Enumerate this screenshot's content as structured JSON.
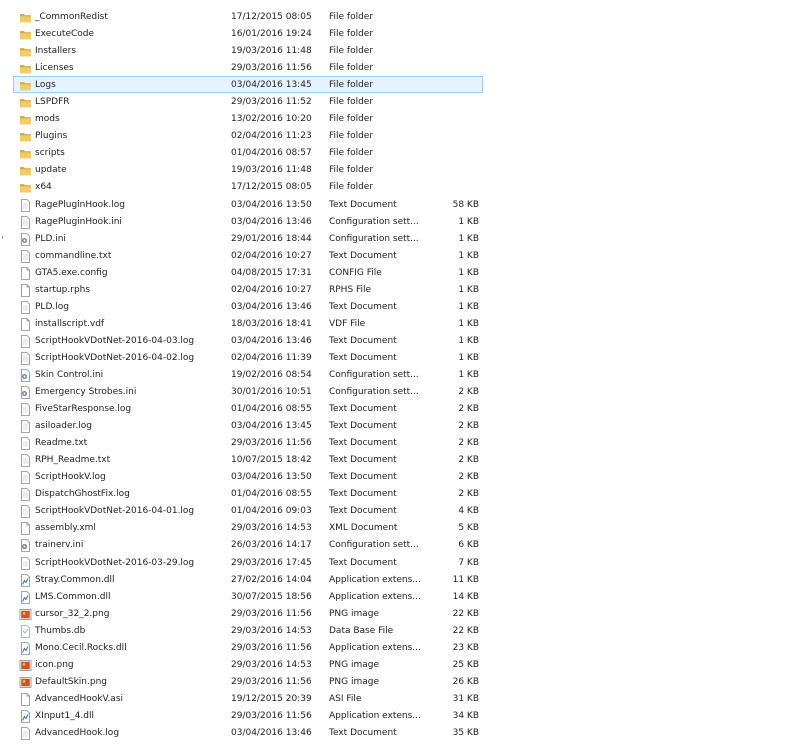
{
  "colors": {
    "selection_bg": "#e5f3ff",
    "selection_border": "#99d1ff",
    "folder": "#e8c153"
  },
  "files": [
    {
      "name": "_CommonRedist",
      "date": "17/12/2015 08:05",
      "type": "File folder",
      "size": "",
      "icon": "folder-icon"
    },
    {
      "name": "ExecuteCode",
      "date": "16/01/2016 19:24",
      "type": "File folder",
      "size": "",
      "icon": "folder-icon"
    },
    {
      "name": "Installers",
      "date": "19/03/2016 11:48",
      "type": "File folder",
      "size": "",
      "icon": "folder-icon"
    },
    {
      "name": "Licenses",
      "date": "29/03/2016 11:56",
      "type": "File folder",
      "size": "",
      "icon": "folder-icon"
    },
    {
      "name": "Logs",
      "date": "03/04/2016 13:45",
      "type": "File folder",
      "size": "",
      "icon": "folder-icon",
      "selected": true
    },
    {
      "name": "LSPDFR",
      "date": "29/03/2016 11:52",
      "type": "File folder",
      "size": "",
      "icon": "folder-icon"
    },
    {
      "name": "mods",
      "date": "13/02/2016 10:20",
      "type": "File folder",
      "size": "",
      "icon": "folder-icon"
    },
    {
      "name": "Plugins",
      "date": "02/04/2016 11:23",
      "type": "File folder",
      "size": "",
      "icon": "folder-icon"
    },
    {
      "name": "scripts",
      "date": "01/04/2016 08:57",
      "type": "File folder",
      "size": "",
      "icon": "folder-icon"
    },
    {
      "name": "update",
      "date": "19/03/2016 11:48",
      "type": "File folder",
      "size": "",
      "icon": "folder-icon"
    },
    {
      "name": "x64",
      "date": "17/12/2015 08:05",
      "type": "File folder",
      "size": "",
      "icon": "folder-icon"
    },
    {
      "name": "RagePluginHook.log",
      "date": "03/04/2016 13:50",
      "type": "Text Document",
      "size": "58 KB",
      "icon": "text-file-icon"
    },
    {
      "name": "RagePluginHook.ini",
      "date": "03/04/2016 13:46",
      "type": "Configuration sett...",
      "size": "1 KB",
      "icon": "text-file-icon"
    },
    {
      "name": "PLD.ini",
      "date": "29/01/2016 18:44",
      "type": "Configuration sett...",
      "size": "1 KB",
      "icon": "config-file-icon"
    },
    {
      "name": "commandline.txt",
      "date": "02/04/2016 10:27",
      "type": "Text Document",
      "size": "1 KB",
      "icon": "text-file-icon"
    },
    {
      "name": "GTA5.exe.config",
      "date": "04/08/2015 17:31",
      "type": "CONFIG File",
      "size": "1 KB",
      "icon": "blank-file-icon"
    },
    {
      "name": "startup.rphs",
      "date": "02/04/2016 10:27",
      "type": "RPHS File",
      "size": "1 KB",
      "icon": "blank-file-icon"
    },
    {
      "name": "PLD.log",
      "date": "03/04/2016 13:46",
      "type": "Text Document",
      "size": "1 KB",
      "icon": "text-file-icon"
    },
    {
      "name": "installscript.vdf",
      "date": "18/03/2016 18:41",
      "type": "VDF File",
      "size": "1 KB",
      "icon": "blank-file-icon"
    },
    {
      "name": "ScriptHookVDotNet-2016-04-03.log",
      "date": "03/04/2016 13:46",
      "type": "Text Document",
      "size": "1 KB",
      "icon": "text-file-icon"
    },
    {
      "name": "ScriptHookVDotNet-2016-04-02.log",
      "date": "02/04/2016 11:39",
      "type": "Text Document",
      "size": "1 KB",
      "icon": "text-file-icon"
    },
    {
      "name": "Skin Control.ini",
      "date": "19/02/2016 08:54",
      "type": "Configuration sett...",
      "size": "1 KB",
      "icon": "config-file-icon"
    },
    {
      "name": "Emergency Strobes.ini",
      "date": "30/01/2016 10:51",
      "type": "Configuration sett...",
      "size": "2 KB",
      "icon": "config-file-icon"
    },
    {
      "name": "FiveStarResponse.log",
      "date": "01/04/2016 08:55",
      "type": "Text Document",
      "size": "2 KB",
      "icon": "text-file-icon"
    },
    {
      "name": "asiloader.log",
      "date": "03/04/2016 13:45",
      "type": "Text Document",
      "size": "2 KB",
      "icon": "text-file-icon"
    },
    {
      "name": "Readme.txt",
      "date": "29/03/2016 11:56",
      "type": "Text Document",
      "size": "2 KB",
      "icon": "text-file-icon"
    },
    {
      "name": "RPH_Readme.txt",
      "date": "10/07/2015 18:42",
      "type": "Text Document",
      "size": "2 KB",
      "icon": "text-file-icon"
    },
    {
      "name": "ScriptHookV.log",
      "date": "03/04/2016 13:50",
      "type": "Text Document",
      "size": "2 KB",
      "icon": "text-file-icon"
    },
    {
      "name": "DispatchGhostFix.log",
      "date": "01/04/2016 08:55",
      "type": "Text Document",
      "size": "2 KB",
      "icon": "text-file-icon"
    },
    {
      "name": "ScriptHookVDotNet-2016-04-01.log",
      "date": "01/04/2016 09:03",
      "type": "Text Document",
      "size": "4 KB",
      "icon": "text-file-icon"
    },
    {
      "name": "assembly.xml",
      "date": "29/03/2016 14:53",
      "type": "XML Document",
      "size": "5 KB",
      "icon": "blank-file-icon"
    },
    {
      "name": "trainerv.ini",
      "date": "26/03/2016 14:17",
      "type": "Configuration sett...",
      "size": "6 KB",
      "icon": "config-file-icon"
    },
    {
      "name": "ScriptHookVDotNet-2016-03-29.log",
      "date": "29/03/2016 17:45",
      "type": "Text Document",
      "size": "7 KB",
      "icon": "text-file-icon"
    },
    {
      "name": "Stray.Common.dll",
      "date": "27/02/2016 14:04",
      "type": "Application extens...",
      "size": "11 KB",
      "icon": "dll-file-icon"
    },
    {
      "name": "LMS.Common.dll",
      "date": "30/07/2015 18:56",
      "type": "Application extens...",
      "size": "14 KB",
      "icon": "dll-file-icon"
    },
    {
      "name": "cursor_32_2.png",
      "date": "29/03/2016 11:56",
      "type": "PNG image",
      "size": "22 KB",
      "icon": "image-file-icon"
    },
    {
      "name": "Thumbs.db",
      "date": "29/03/2016 14:53",
      "type": "Data Base File",
      "size": "22 KB",
      "icon": "db-file-icon"
    },
    {
      "name": "Mono.Cecil.Rocks.dll",
      "date": "29/03/2016 11:56",
      "type": "Application extens...",
      "size": "23 KB",
      "icon": "dll-file-icon"
    },
    {
      "name": "icon.png",
      "date": "29/03/2016 14:53",
      "type": "PNG image",
      "size": "25 KB",
      "icon": "image-file-icon"
    },
    {
      "name": "DefaultSkin.png",
      "date": "29/03/2016 11:56",
      "type": "PNG image",
      "size": "26 KB",
      "icon": "image-file-icon"
    },
    {
      "name": "AdvancedHookV.asi",
      "date": "19/12/2015 20:39",
      "type": "ASI File",
      "size": "31 KB",
      "icon": "blank-file-icon"
    },
    {
      "name": "XInput1_4.dll",
      "date": "29/03/2016 11:56",
      "type": "Application extens...",
      "size": "34 KB",
      "icon": "dll-file-icon"
    },
    {
      "name": "AdvancedHook.log",
      "date": "03/04/2016 13:46",
      "type": "Text Document",
      "size": "35 KB",
      "icon": "text-file-icon"
    }
  ]
}
